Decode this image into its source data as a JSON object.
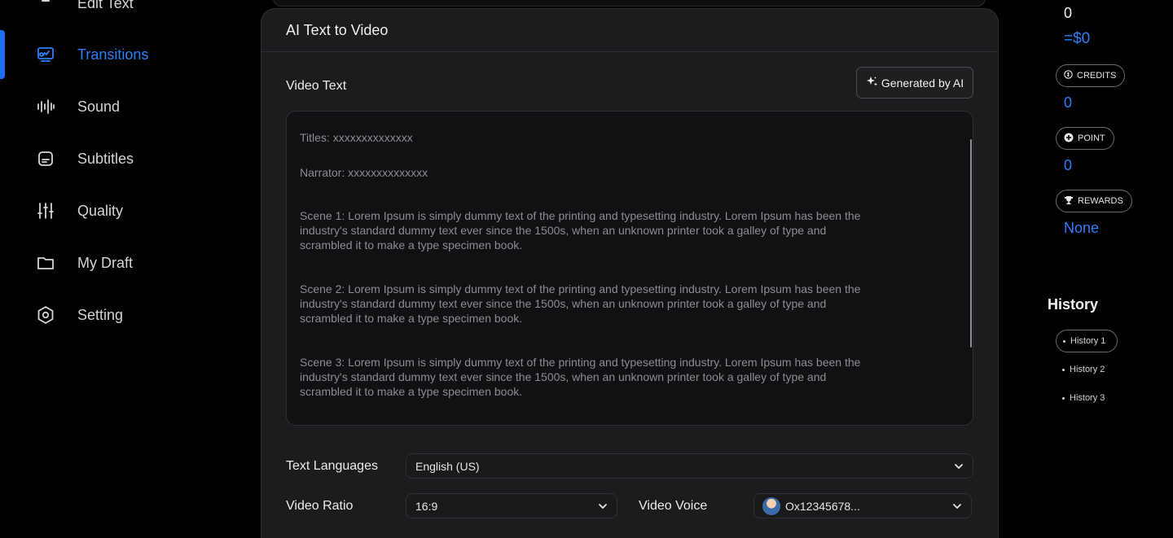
{
  "sidebar": {
    "items": [
      {
        "label": "Edit Text",
        "icon": "text-icon"
      },
      {
        "label": "Transitions",
        "icon": "transitions-icon",
        "active": true
      },
      {
        "label": "Sound",
        "icon": "waveform-icon"
      },
      {
        "label": "Subtitles",
        "icon": "subtitles-icon"
      },
      {
        "label": "Quality",
        "icon": "sliders-icon"
      },
      {
        "label": "My Draft",
        "icon": "folder-icon"
      },
      {
        "label": "Setting",
        "icon": "gear-icon"
      }
    ],
    "accent": "#2d7ff9"
  },
  "modal": {
    "title": "AI Text to Video",
    "video_text_label": "Video Text",
    "generate_button": "Generated by AI",
    "textarea_lines": [
      "Titles: xxxxxxxxxxxxxx",
      "Narrator: xxxxxxxxxxxxxx",
      "Scene 1: Lorem Ipsum is simply dummy text of the printing and typesetting industry. Lorem Ipsum has been the industry's standard dummy text ever since the 1500s, when an unknown printer took a galley of type and scrambled it to make a type specimen book.",
      "Scene 2: Lorem Ipsum is simply dummy text of the printing and typesetting industry. Lorem Ipsum has been the industry's standard dummy text ever since the 1500s, when an unknown printer took a galley of type and scrambled it to make a type specimen book.",
      "Scene 3: Lorem Ipsum is simply dummy text of the printing and typesetting industry. Lorem Ipsum has been the industry's standard dummy text ever since the 1500s, when an unknown printer took a galley of type and scrambled it to make a type specimen book."
    ],
    "text_languages_label": "Text Languages",
    "text_languages_value": "English (US)",
    "video_ratio_label": "Video Ratio",
    "video_ratio_value": "16:9",
    "video_voice_label": "Video Voice",
    "video_voice_value": "Ox12345678..."
  },
  "right_panel": {
    "balance": "0",
    "balance_usd": "=$0",
    "credits_label": "CREDITS",
    "credits_value": "0",
    "point_label": "POINT",
    "point_value": "0",
    "rewards_label": "REWARDS",
    "rewards_value": "None",
    "history_title": "History",
    "history_items": [
      "History 1",
      "History 2",
      "History 3"
    ]
  }
}
